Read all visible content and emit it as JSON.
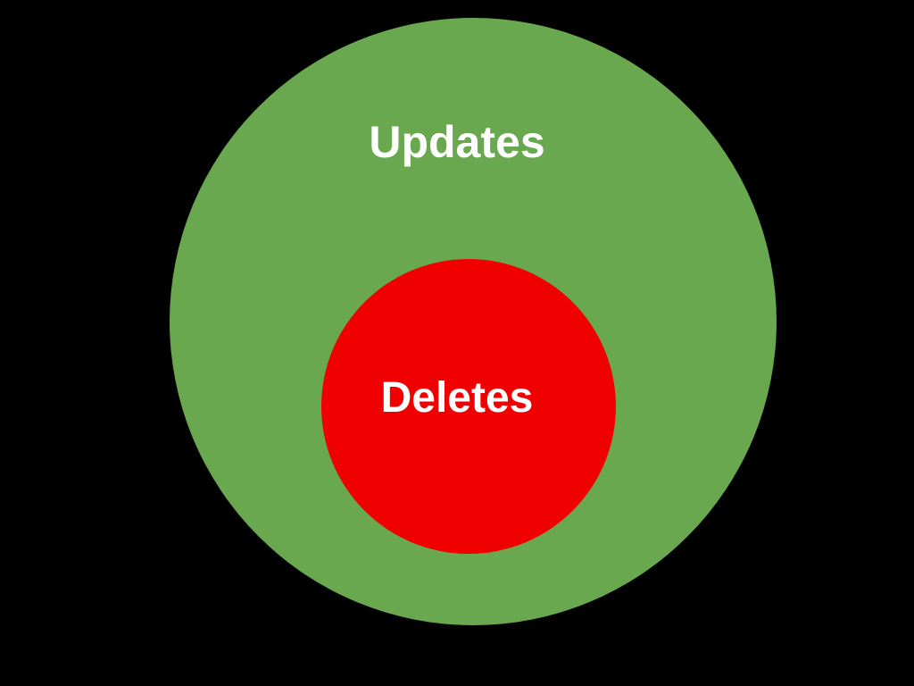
{
  "diagram": {
    "outer": {
      "label": "Updates",
      "color": "#6aa84f"
    },
    "inner": {
      "label": "Deletes",
      "color": "#f00000"
    }
  }
}
